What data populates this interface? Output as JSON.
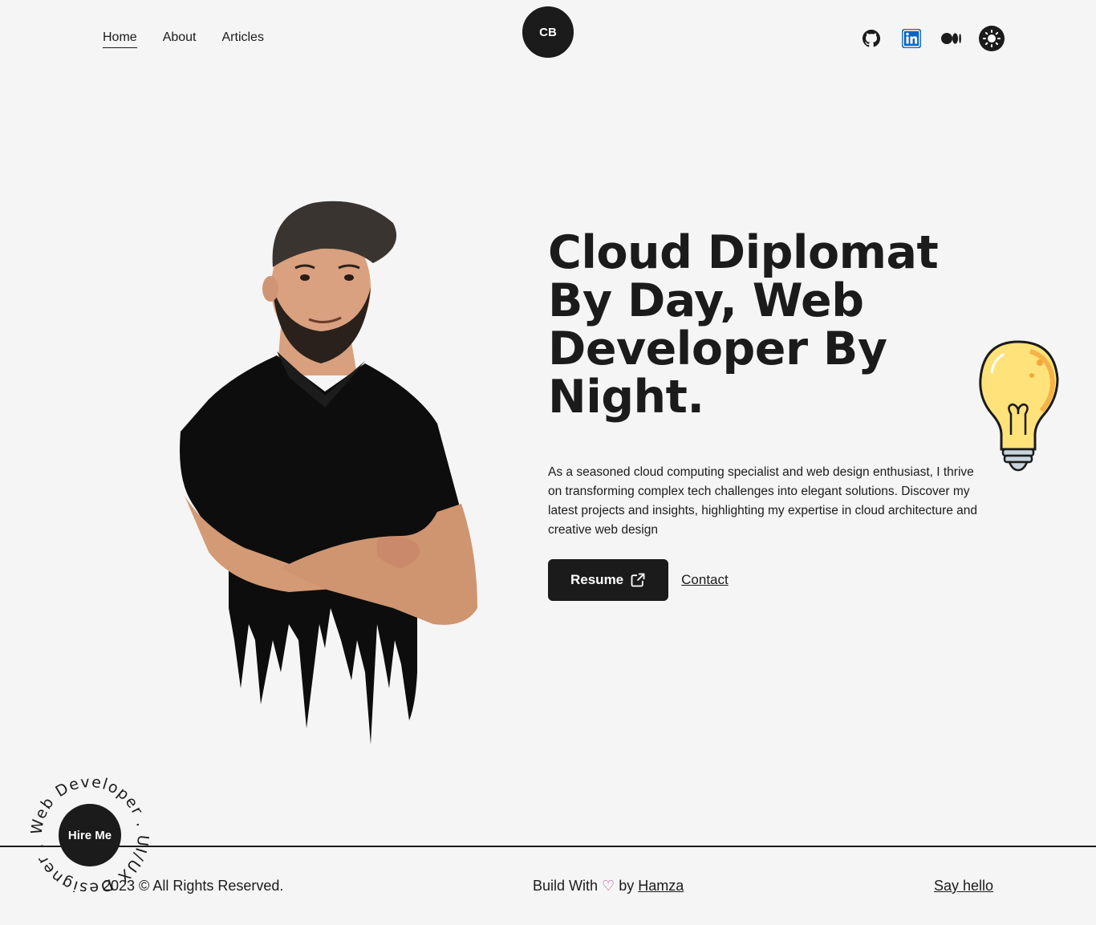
{
  "nav": {
    "home": "Home",
    "about": "About",
    "articles": "Articles"
  },
  "logo": {
    "text": "CB"
  },
  "social": {
    "icons": [
      "github-icon",
      "linkedin-icon",
      "medium-icon",
      "sun-icon"
    ],
    "linkedin_color": "#0a66c2"
  },
  "hero": {
    "headline": "Cloud Diplomat By Day, Web Developer By Night.",
    "description": "As a seasoned cloud computing specialist and web design enthusiast, I thrive on transforming complex tech challenges into elegant solutions. Discover my latest projects and insights, highlighting my expertise in cloud architecture and creative web design",
    "resume_label": "Resume",
    "contact_label": "Contact"
  },
  "hire": {
    "label": "Hire Me",
    "ring_text": "Web Developer . UI/UX Designer . "
  },
  "footer": {
    "copyright": "2023 © All Rights Reserved.",
    "build_prefix": "Build With",
    "build_by": "by",
    "author": "Hamza",
    "say_hello": "Say hello"
  },
  "colors": {
    "dark": "#1b1b1b",
    "background": "#f5f5f5",
    "heart": "#b63e96",
    "bulb": "#ffd84d"
  }
}
